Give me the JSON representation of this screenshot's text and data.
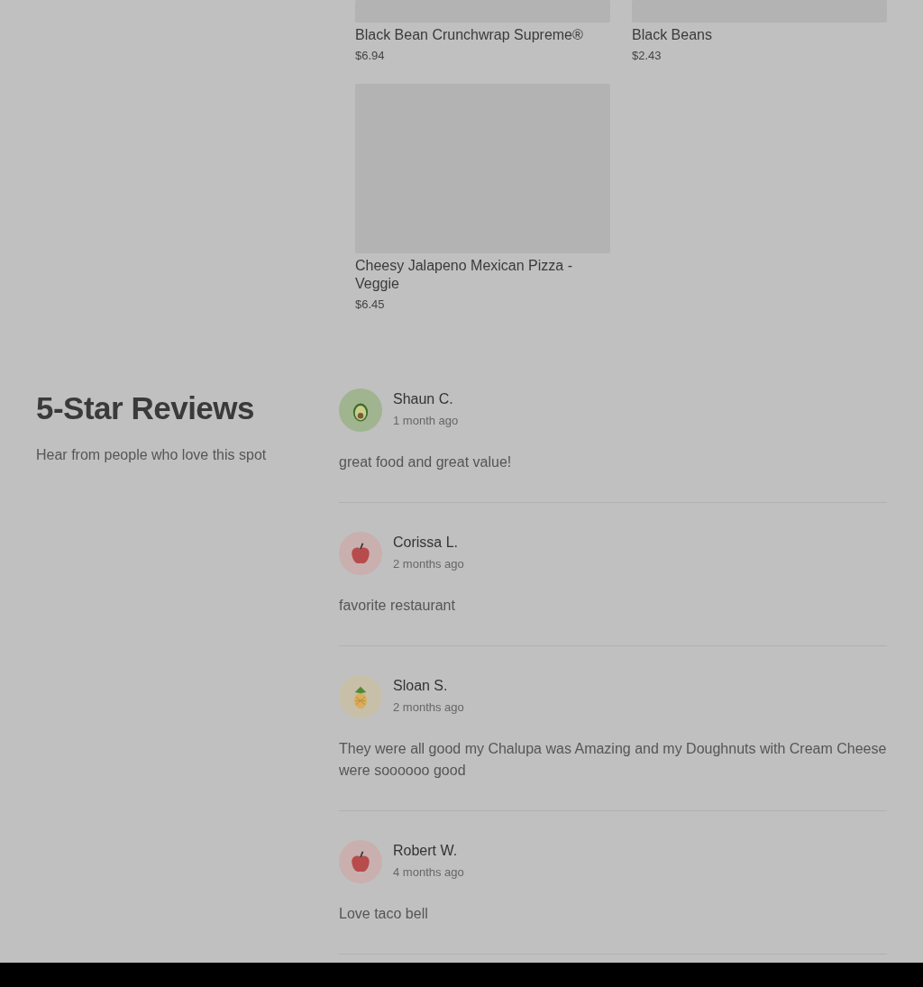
{
  "menu_items": [
    {
      "name": "Black Bean Crunchwrap Supreme®",
      "price": "$6.94",
      "image": {
        "kind": "placeholder",
        "cut": true
      }
    },
    {
      "name": "Black Beans",
      "price": "$2.43",
      "image": {
        "kind": "placeholder",
        "cut": true
      }
    },
    {
      "name": "Cheesy Jalapeno Mexican Pizza - Veggie",
      "price": "$6.45",
      "image": {
        "kind": "placeholder",
        "cut": false
      }
    }
  ],
  "reviews_section": {
    "title": "5-Star Reviews",
    "subtitle": "Hear from people who love this spot"
  },
  "reviews": [
    {
      "name": "Shaun C.",
      "time": "1 month ago",
      "text": "great food and great value!",
      "avatar": {
        "kind": "avocado"
      }
    },
    {
      "name": "Corissa L.",
      "time": "2 months ago",
      "text": "favorite restaurant",
      "avatar": {
        "kind": "apple"
      }
    },
    {
      "name": "Sloan S.",
      "time": "2 months ago",
      "text": "They were all good my Chalupa was Amazing and my Doughnuts with Cream Cheese were soooooo good",
      "avatar": {
        "kind": "pineapple"
      }
    },
    {
      "name": "Robert W.",
      "time": "4 months ago",
      "text": "Love taco bell",
      "avatar": {
        "kind": "apple"
      }
    }
  ]
}
